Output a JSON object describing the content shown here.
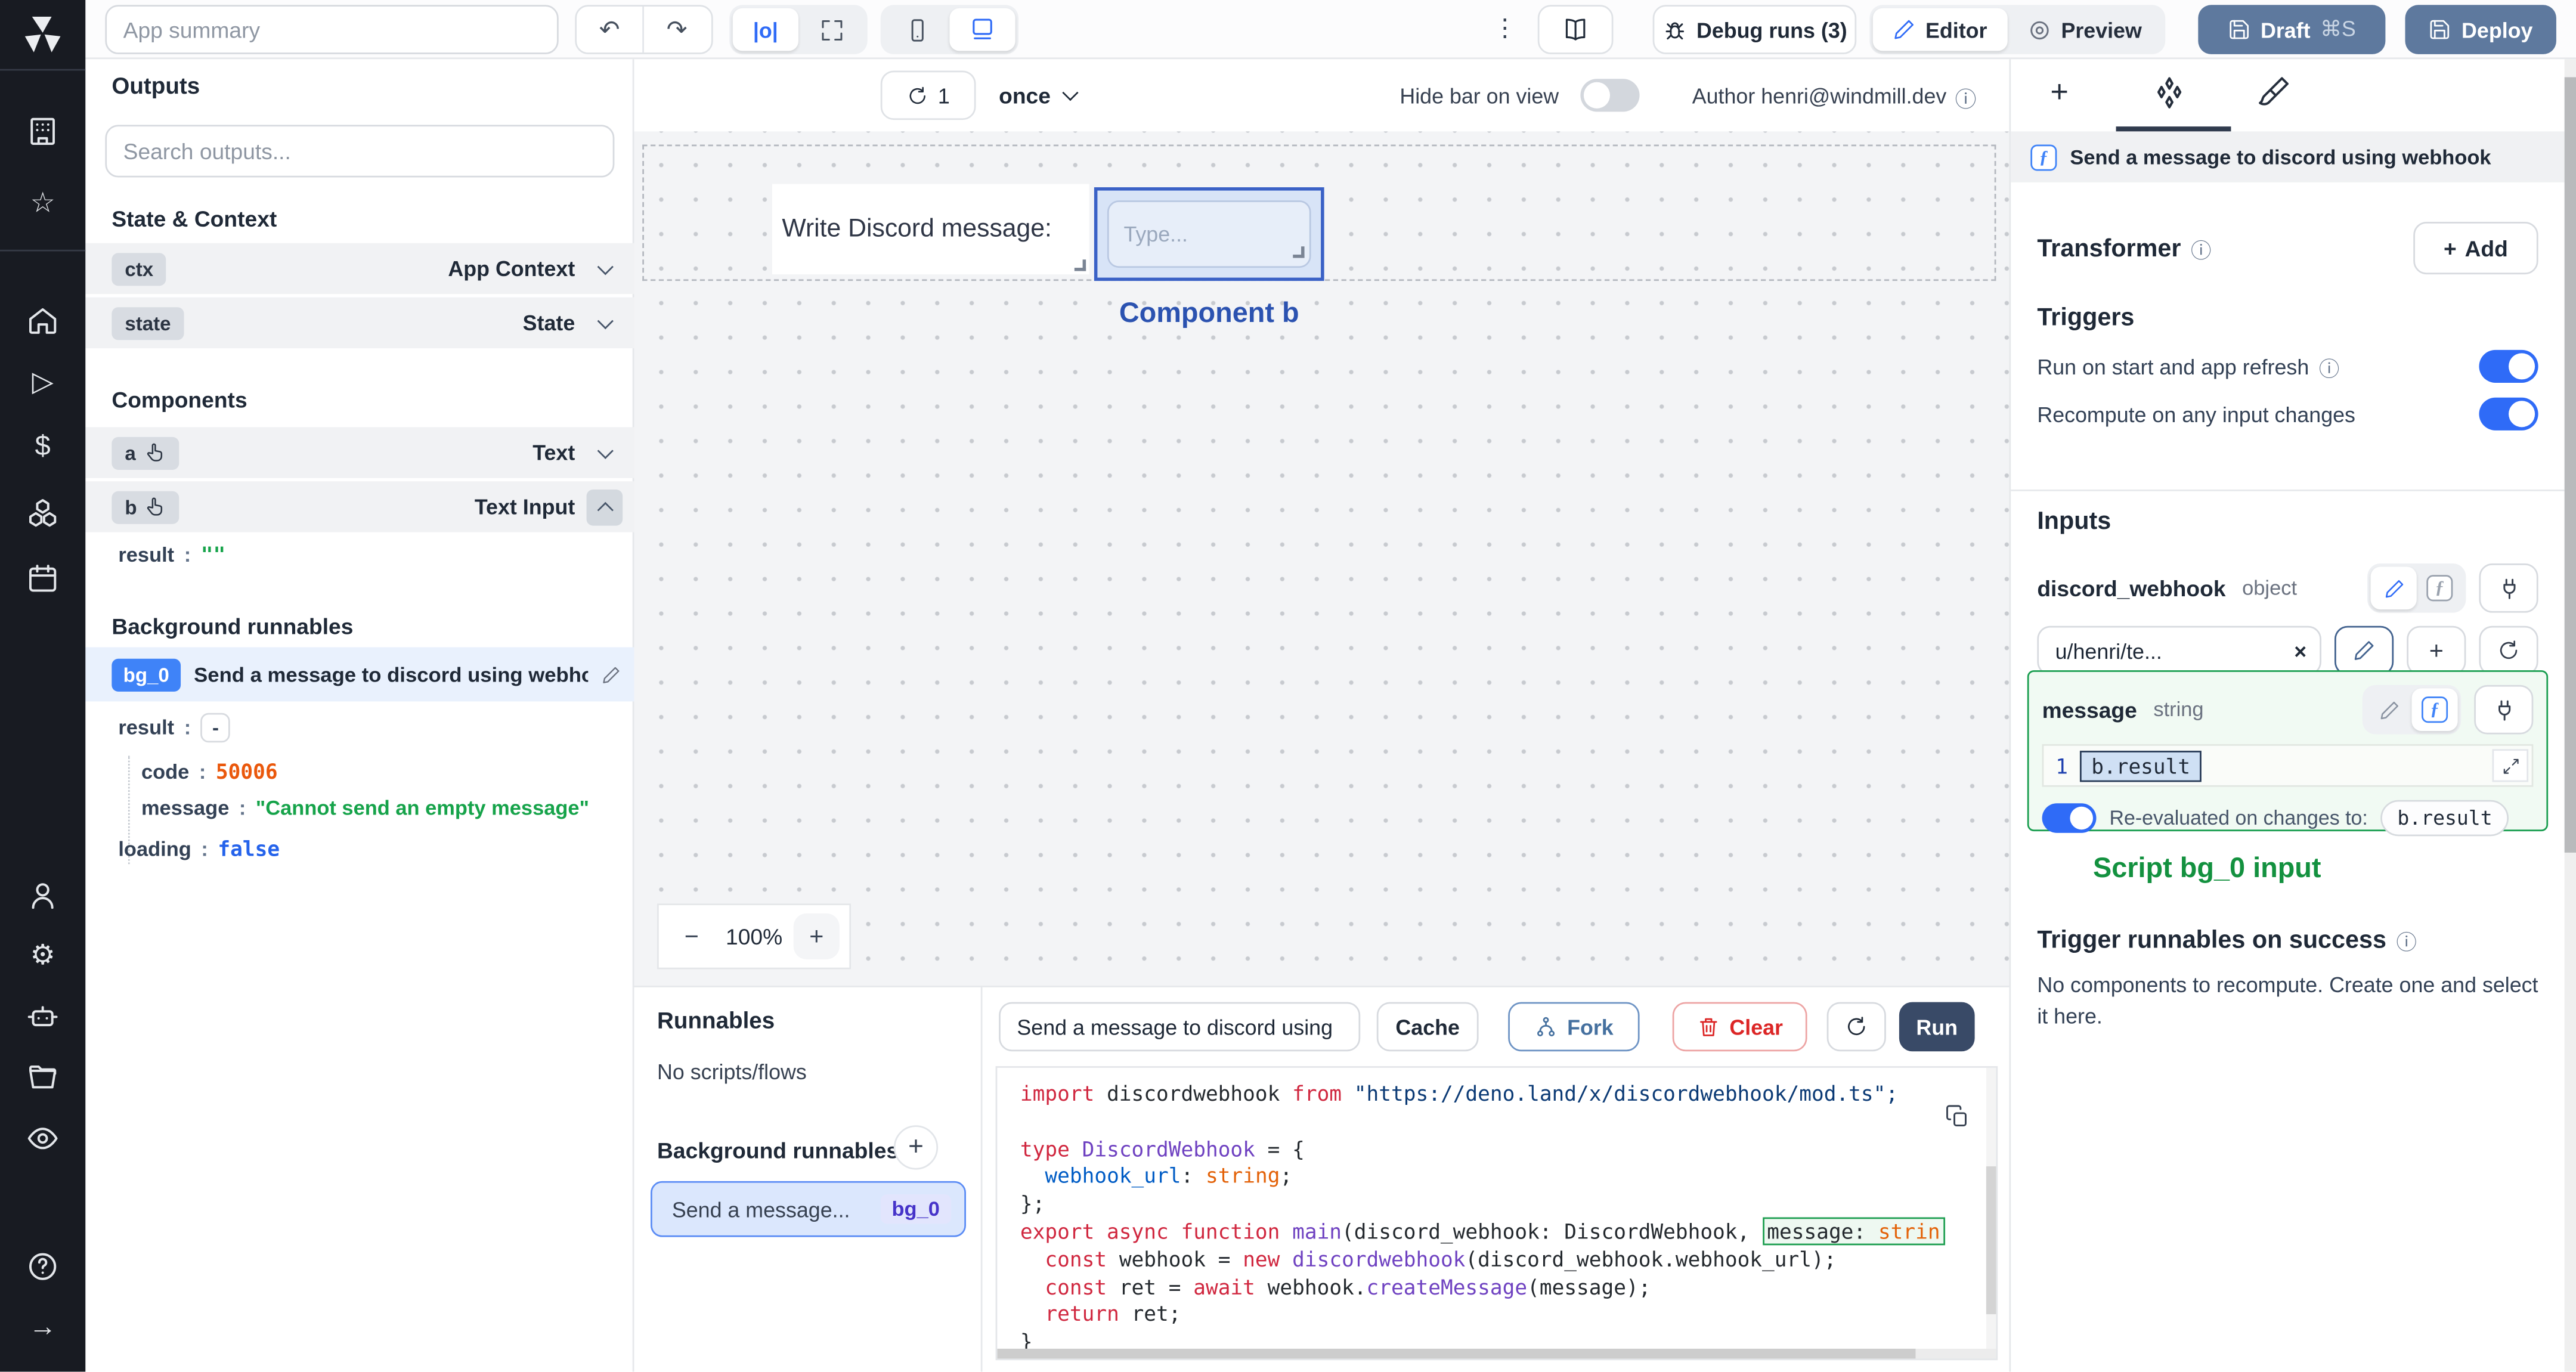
{
  "icons": {
    "undo": "↶",
    "redo": "↷",
    "kebab": "⋮",
    "close": "×",
    "plus": "+",
    "minus": "−",
    "info": "ⓘ",
    "dollar": "$",
    "play": "▷",
    "star": "☆",
    "gear": "⚙",
    "arrow_right": "→",
    "question": "?",
    "fn": "ƒ",
    "align": "|o|",
    "collapse_dash": "-"
  },
  "topbar": {
    "app_summary_placeholder": "App summary",
    "debug_runs_label": "Debug runs (3)",
    "editor_label": "Editor",
    "preview_label": "Preview",
    "draft_label": "Draft",
    "draft_shortcut": "⌘S",
    "deploy_label": "Deploy"
  },
  "outputs_panel": {
    "title": "Outputs",
    "search_placeholder": "Search outputs...",
    "state_context_title": "State & Context",
    "ctx_badge": "ctx",
    "ctx_type": "App Context",
    "state_badge": "state",
    "state_type": "State",
    "components_title": "Components",
    "comp_a_badge": "a",
    "comp_a_type": "Text",
    "comp_b_badge": "b",
    "comp_b_type": "Text Input",
    "b_result_key": "result",
    "b_result_value": "\"\"",
    "bg_title": "Background runnables",
    "bg_badge": "bg_0",
    "bg_name": "Send a message to discord using webhook",
    "bg_result_key": "result",
    "bg_result_collapse": "-",
    "bg_code_key": "code",
    "bg_code_value": "50006",
    "bg_message_key": "message",
    "bg_message_value": "\"Cannot send an empty message\"",
    "bg_loading_key": "loading",
    "bg_loading_value": "false"
  },
  "canvas": {
    "refresh_count": "1",
    "run_mode": "once",
    "hide_bar_label": "Hide bar on view",
    "author_label": "Author henri@windmill.dev",
    "text_component": "Write Discord message:",
    "input_placeholder": "Type...",
    "selected_component_label": "Component b",
    "zoom_level": "100%"
  },
  "runnables_panel": {
    "title": "Runnables",
    "empty_label": "No scripts/flows",
    "bg_title": "Background runnables",
    "item_name": "Send a message...",
    "item_badge": "bg_0"
  },
  "editor_panel": {
    "script_name": "Send a message to discord using",
    "cache_label": "Cache",
    "fork_label": "Fork",
    "clear_label": "Clear",
    "run_label": "Run",
    "code_lines": [
      [
        {
          "t": "import ",
          "c": "k"
        },
        {
          "t": "discordwebhook ",
          "c": "d"
        },
        {
          "t": "from ",
          "c": "k"
        },
        {
          "t": "\"https://deno.land/x/discordwebhook/mod.ts\";",
          "c": "s"
        }
      ],
      [],
      [
        {
          "t": "type ",
          "c": "k"
        },
        {
          "t": "DiscordWebhook ",
          "c": "t"
        },
        {
          "t": "= {",
          "c": "d"
        }
      ],
      [
        {
          "t": "  ",
          "c": "d"
        },
        {
          "t": "webhook_url",
          "c": "p"
        },
        {
          "t": ": ",
          "c": "d"
        },
        {
          "t": "string",
          "c": "o"
        },
        {
          "t": ";",
          "c": "d"
        }
      ],
      [
        {
          "t": "};",
          "c": "d"
        }
      ],
      [
        {
          "t": "export async function ",
          "c": "k"
        },
        {
          "t": "main",
          "c": "t"
        },
        {
          "t": "(discord_webhook: DiscordWebhook, ",
          "c": "d"
        },
        {
          "box": [
            {
              "t": "message: ",
              "c": "d"
            },
            {
              "t": "strin",
              "c": "o"
            }
          ]
        }
      ],
      [
        {
          "t": "  ",
          "c": "d"
        },
        {
          "t": "const ",
          "c": "k"
        },
        {
          "t": "webhook = ",
          "c": "d"
        },
        {
          "t": "new ",
          "c": "k"
        },
        {
          "t": "discordwebhook",
          "c": "t"
        },
        {
          "t": "(discord_webhook.webhook_url);",
          "c": "d"
        }
      ],
      [
        {
          "t": "  ",
          "c": "d"
        },
        {
          "t": "const ",
          "c": "k"
        },
        {
          "t": "ret = ",
          "c": "d"
        },
        {
          "t": "await ",
          "c": "k"
        },
        {
          "t": "webhook.",
          "c": "d"
        },
        {
          "t": "createMessage",
          "c": "t"
        },
        {
          "t": "(message);",
          "c": "d"
        }
      ],
      [
        {
          "t": "  ",
          "c": "d"
        },
        {
          "t": "return ",
          "c": "k"
        },
        {
          "t": "ret;",
          "c": "d"
        }
      ],
      [
        {
          "t": "}",
          "c": "d"
        }
      ]
    ]
  },
  "settings_panel": {
    "header_title": "Send a message to discord using webhook",
    "transformer_label": "Transformer",
    "add_label": "Add",
    "triggers_title": "Triggers",
    "trigger_run_on_start": "Run on start and app refresh",
    "trigger_recompute": "Recompute on any input changes",
    "inputs_title": "Inputs",
    "input1_name": "discord_webhook",
    "input1_type": "object",
    "input1_value": "u/henri/te...",
    "input2_name": "message",
    "input2_type": "string",
    "input2_line_number": "1",
    "input2_value": "b.result",
    "reeval_label": "Re-evaluated on changes to:",
    "reeval_target": "b.result",
    "annotation": "Script bg_0 input",
    "on_success_title": "Trigger runnables on success",
    "on_success_text": "No components to recompute. Create one and select it here."
  }
}
